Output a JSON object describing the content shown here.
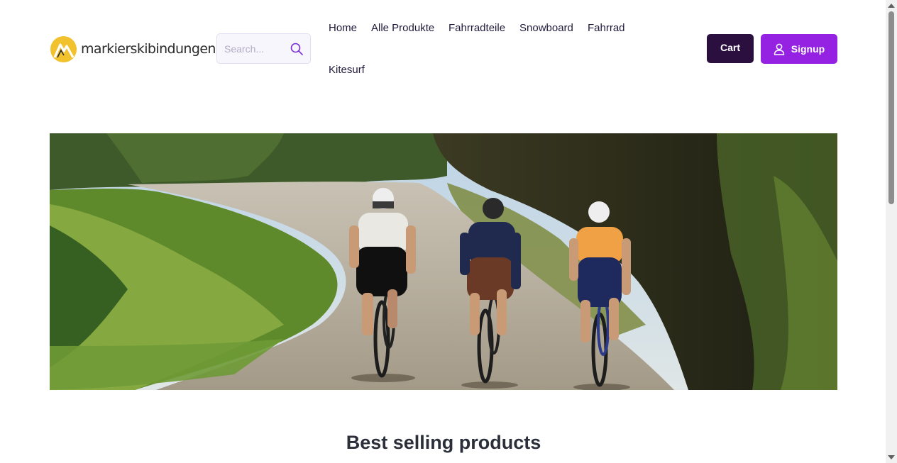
{
  "header": {
    "logo_text": "markierskibindungen",
    "search": {
      "placeholder": "Search..."
    },
    "nav": [
      {
        "label": "Home"
      },
      {
        "label": "Alle Produkte"
      },
      {
        "label": "Fahrradteile"
      },
      {
        "label": "Snowboard"
      },
      {
        "label": "Fahrrad"
      },
      {
        "label": "Kitesurf"
      }
    ],
    "cart_label": "Cart",
    "signup_label": "Signup"
  },
  "hero": {
    "image": "cyclists-on-country-road"
  },
  "sections": {
    "best_selling_title": "Best selling products"
  },
  "icons": {
    "logo": "mountain-logo-icon",
    "search": "search-icon",
    "user": "user-icon"
  },
  "colors": {
    "cart_button": "#2a0f3f",
    "signup_button": "#9521e3",
    "search_icon": "#7b2fd6",
    "logo_circle": "#f2c12e",
    "title_text": "#2a2f3a"
  }
}
